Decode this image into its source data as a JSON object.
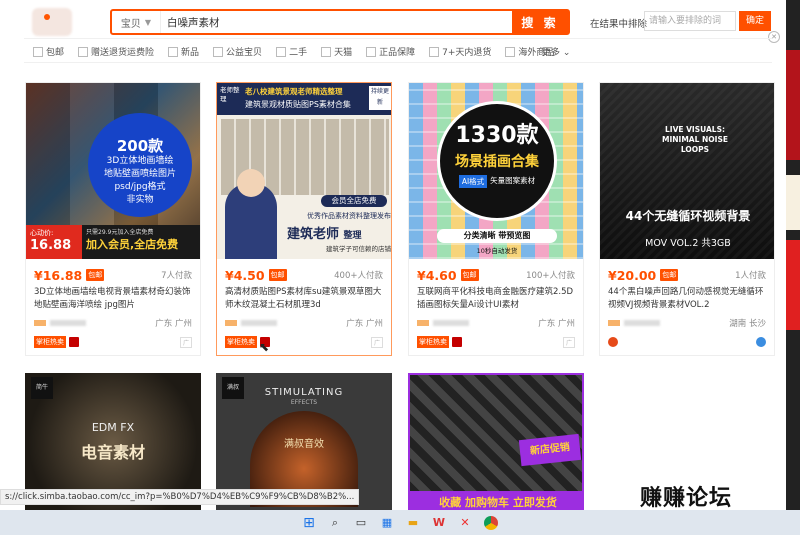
{
  "search": {
    "category": "宝贝",
    "query": "白噪声素材",
    "button": "搜 索"
  },
  "exclude": {
    "label": "在结果中排除",
    "placeholder": "请输入要排除的词",
    "button": "确定"
  },
  "filters": [
    "包邮",
    "赠送退货运费险",
    "新品",
    "公益宝贝",
    "二手",
    "天猫",
    "正品保障",
    "7+天内退货",
    "海外商品"
  ],
  "more_label": "更多",
  "products": [
    {
      "price": "¥16.88",
      "tag": "包邮",
      "buyers": "7人付款",
      "title": "3D立体地画墙绘电视背景墙素材奇幻装饰地贴壁画海洋喷绘 jpg图片",
      "location": "广东 广州",
      "badge": "掌柜热卖",
      "thumb": {
        "circle_title": "200款",
        "lines": [
          "3D立体地画墙绘",
          "地贴壁画喷绘图片",
          "psd/jpg格式",
          "非实物"
        ],
        "banner_price_label": "心动价:",
        "banner_price": "16.88",
        "banner_text": "加入会员,全店免费",
        "banner_sub": "只需29.9元加入全店免费"
      }
    },
    {
      "price": "¥4.50",
      "tag": "包邮",
      "buyers": "400+人付款",
      "title": "高清材质贴图PS素材库su建筑景观草图大师木纹混凝土石材肌理3d",
      "location": "广东 广州",
      "badge": "掌柜热卖",
      "thumb": {
        "top_tag": "老师整理",
        "top_title": "老八校建筑景观老师精选整理",
        "sub_title": "建筑景观材质贴图PS素材合集",
        "right_tag": "持续更新",
        "member": "会员全店免费",
        "desc": "优秀作品素材资料整理发布",
        "big": "建筑老师",
        "big2": "整理",
        "foot": "建筑学子可信赖的店铺"
      }
    },
    {
      "price": "¥4.60",
      "tag": "包邮",
      "buyers": "100+人付款",
      "title": "互联网商平化科技电商金融医疗建筑2.5D插画图标矢量Ai设计UI素材",
      "location": "广东 广州",
      "badge": "掌柜热卖",
      "thumb": {
        "count": "1330款",
        "title": "场景插画合集",
        "format": "AI格式",
        "vector": "矢量图案素材",
        "clear": "分类清晰 带预览图",
        "auto": "10秒自动发货"
      }
    },
    {
      "price": "¥20.00",
      "tag": "包邮",
      "buyers": "1人付款",
      "title": "44个黑白噪声回路几何动感视觉无缝循环视频VJ视频背景素材VOL.2",
      "location": "湖南 长沙",
      "thumb": {
        "l1": "LIVE VISUALS:",
        "l2": "MINIMAL NOISE",
        "l3": "LOOPS",
        "main": "44个无缝循环视频背景",
        "sub": "MOV VOL.2 共3GB"
      }
    }
  ],
  "row2": [
    {
      "thumb": {
        "corner": "简牛",
        "label": "EDM FX",
        "sub": "电音素材"
      }
    },
    {
      "thumb": {
        "corner": "满叔",
        "title": "STIMULATING",
        "sub": "EFFECTS",
        "bottom": "满叔音效"
      }
    },
    {
      "thumb": {
        "promo": "新店促销",
        "banner": "收藏 加购物车 立即发货"
      }
    }
  ],
  "status_url": "s://click.simba.taobao.com/cc_im?p=%B0%D7%D4%EB%C9%F9%CB%D8%B2%...",
  "watermark": "赚赚论坛"
}
